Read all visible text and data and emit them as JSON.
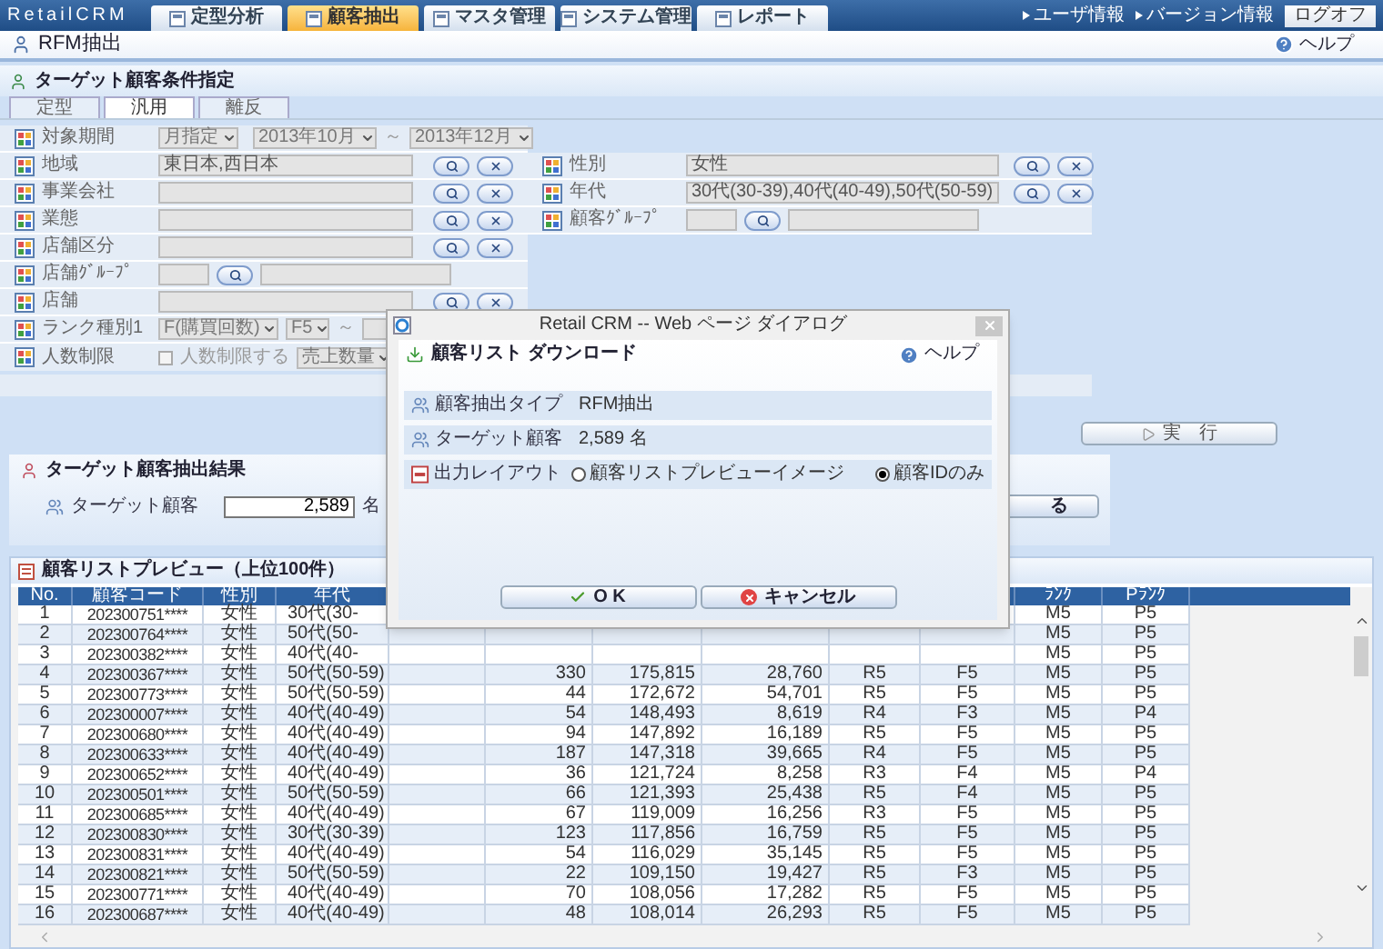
{
  "header": {
    "logo": "RetailCRM",
    "tabs": [
      {
        "label": "定型分析",
        "selected": false
      },
      {
        "label": "顧客抽出",
        "selected": true
      },
      {
        "label": "マスタ管理",
        "selected": false
      },
      {
        "label": "システム管理",
        "selected": false
      },
      {
        "label": "レポート",
        "selected": false
      }
    ],
    "links": [
      "ユーザ情報",
      "バージョン情報"
    ],
    "logout": "ログオフ"
  },
  "page": {
    "title": "RFM抽出",
    "help": "ヘルプ"
  },
  "conditions": {
    "title": "ターゲット顧客条件指定",
    "tabs": [
      {
        "label": "定型",
        "selected": false
      },
      {
        "label": "汎用",
        "selected": true
      },
      {
        "label": "離反",
        "selected": false
      }
    ],
    "period": {
      "label": "対象期間",
      "mode": "月指定",
      "from": "2013年10月",
      "tilde": "～",
      "to": "2013年12月"
    },
    "left_rows": [
      {
        "kind": "text",
        "label": "地域",
        "value": "東日本,西日本"
      },
      {
        "kind": "text",
        "label": "事業会社"
      },
      {
        "kind": "text",
        "label": "業態"
      },
      {
        "kind": "text",
        "label": "店舗区分"
      },
      {
        "kind": "group",
        "label": "店舗ｸﾞﾙｰﾌﾟ"
      },
      {
        "kind": "text",
        "label": "店舗"
      }
    ],
    "right_rows": [
      {
        "kind": "text",
        "label": "性別",
        "value": "女性"
      },
      {
        "kind": "text",
        "label": "年代",
        "value": "30代(30-39),40代(40-49),50代(50-59)"
      },
      {
        "kind": "group",
        "label": "顧客ｸﾞﾙｰﾌﾟ"
      }
    ],
    "rank": {
      "label": "ランク種別1",
      "type": "F(購買回数)",
      "from": "F5",
      "tilde": "～"
    },
    "limit": {
      "label": "人数制限",
      "checkbox_label": "人数制限する",
      "checked": false,
      "select": "売上数量"
    }
  },
  "run_button": "実　行",
  "result": {
    "title": "ターゲット顧客抽出結果",
    "label": "ターゲット顧客",
    "value": "2,589",
    "unit": "名",
    "button": "る"
  },
  "preview": {
    "title": "顧客リストプレビュー（上位100件）",
    "columns": [
      "No.",
      "顧客コード",
      "性別",
      "年代",
      null,
      null,
      null,
      null,
      null,
      null,
      "ﾗﾝｸ",
      "Pﾗﾝｸ"
    ],
    "rows": [
      [
        "1",
        "202300751****",
        "女性",
        "30代(30-",
        null,
        null,
        null,
        null,
        null,
        null,
        "M5",
        "P5"
      ],
      [
        "2",
        "202300764****",
        "女性",
        "50代(50-",
        null,
        null,
        null,
        null,
        null,
        null,
        "M5",
        "P5"
      ],
      [
        "3",
        "202300382****",
        "女性",
        "40代(40-",
        null,
        null,
        null,
        null,
        null,
        null,
        "M5",
        "P5"
      ],
      [
        "4",
        "202300367****",
        "女性",
        "50代(50-59)",
        null,
        "330",
        "175,815",
        "28,760",
        "R5",
        "F5",
        "M5",
        "P5"
      ],
      [
        "5",
        "202300773****",
        "女性",
        "50代(50-59)",
        null,
        "44",
        "172,672",
        "54,701",
        "R5",
        "F5",
        "M5",
        "P5"
      ],
      [
        "6",
        "202300007****",
        "女性",
        "40代(40-49)",
        null,
        "54",
        "148,493",
        "8,619",
        "R4",
        "F3",
        "M5",
        "P4"
      ],
      [
        "7",
        "202300680****",
        "女性",
        "40代(40-49)",
        null,
        "94",
        "147,892",
        "16,189",
        "R5",
        "F5",
        "M5",
        "P5"
      ],
      [
        "8",
        "202300633****",
        "女性",
        "40代(40-49)",
        null,
        "187",
        "147,318",
        "39,665",
        "R4",
        "F5",
        "M5",
        "P5"
      ],
      [
        "9",
        "202300652****",
        "女性",
        "40代(40-49)",
        null,
        "36",
        "121,724",
        "8,258",
        "R3",
        "F4",
        "M5",
        "P4"
      ],
      [
        "10",
        "202300501****",
        "女性",
        "50代(50-59)",
        null,
        "66",
        "121,393",
        "25,438",
        "R5",
        "F4",
        "M5",
        "P5"
      ],
      [
        "11",
        "202300685****",
        "女性",
        "40代(40-49)",
        null,
        "67",
        "119,009",
        "16,256",
        "R3",
        "F5",
        "M5",
        "P5"
      ],
      [
        "12",
        "202300830****",
        "女性",
        "30代(30-39)",
        null,
        "123",
        "117,856",
        "16,759",
        "R5",
        "F5",
        "M5",
        "P5"
      ],
      [
        "13",
        "202300831****",
        "女性",
        "40代(40-49)",
        null,
        "54",
        "116,029",
        "35,145",
        "R5",
        "F5",
        "M5",
        "P5"
      ],
      [
        "14",
        "202300821****",
        "女性",
        "50代(50-59)",
        null,
        "22",
        "109,150",
        "19,427",
        "R5",
        "F3",
        "M5",
        "P5"
      ],
      [
        "15",
        "202300771****",
        "女性",
        "40代(40-49)",
        null,
        "70",
        "108,056",
        "17,282",
        "R5",
        "F5",
        "M5",
        "P5"
      ],
      [
        "16",
        "202300687****",
        "女性",
        "40代(40-49)",
        null,
        "48",
        "108,014",
        "26,293",
        "R5",
        "F5",
        "M5",
        "P5"
      ]
    ]
  },
  "dialog": {
    "title": "Retail CRM -- Web ページ ダイアログ",
    "heading": "顧客リスト ダウンロード",
    "help": "ヘルプ",
    "rows": [
      {
        "label": "顧客抽出タイプ",
        "value": "RFM抽出"
      },
      {
        "label": "ターゲット顧客",
        "value": "2,589 名"
      }
    ],
    "layout": {
      "label": "出力レイアウト",
      "options": [
        {
          "label": "顧客リストプレビューイメージ",
          "selected": false
        },
        {
          "label": "顧客IDのみ",
          "selected": true
        }
      ]
    },
    "ok": "O K",
    "cancel": "キャンセル"
  }
}
